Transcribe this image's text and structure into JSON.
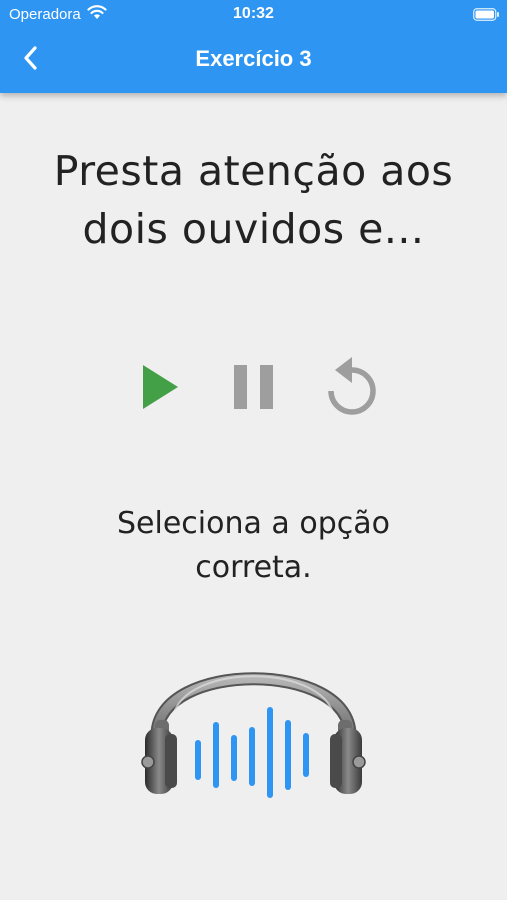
{
  "status_bar": {
    "carrier": "Operadora",
    "time": "10:32",
    "wifi_icon": "wifi-icon",
    "battery_icon": "battery-icon"
  },
  "nav": {
    "title": "Exercício 3",
    "back_icon": "chevron-left-icon"
  },
  "exercise": {
    "instruction": "Presta atenção aos dois ouvidos e...",
    "select_prompt": "Seleciona a opção correta."
  },
  "controls": [
    {
      "name": "play",
      "icon": "play-icon",
      "color": "#43a047"
    },
    {
      "name": "pause",
      "icon": "pause-icon",
      "color": "#9e9e9e"
    },
    {
      "name": "replay",
      "icon": "replay-icon",
      "color": "#9e9e9e"
    }
  ],
  "illustration": {
    "icon": "headphones-soundwave-icon"
  },
  "colors": {
    "header": "#2e95f3",
    "background": "#efefef",
    "sound_wave": "#2e95f3"
  }
}
